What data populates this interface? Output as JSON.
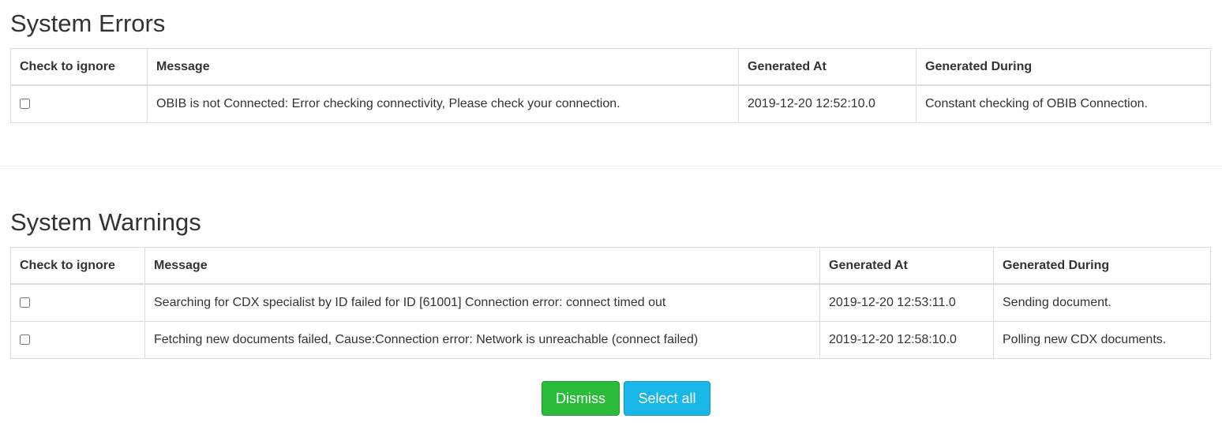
{
  "errors": {
    "title": "System Errors",
    "headers": [
      "Check to ignore",
      "Message",
      "Generated At",
      "Generated During"
    ],
    "rows": [
      {
        "message": "OBIB is not Connected: Error checking connectivity, Please check your connection.",
        "generated_at": "2019-12-20 12:52:10.0",
        "generated_during": "Constant checking of OBIB Connection."
      }
    ]
  },
  "warnings": {
    "title": "System Warnings",
    "headers": [
      "Check to ignore",
      "Message",
      "Generated At",
      "Generated During"
    ],
    "rows": [
      {
        "message": "Searching for CDX specialist by ID failed for ID [61001] Connection error: connect timed out",
        "generated_at": "2019-12-20 12:53:11.0",
        "generated_during": "Sending document."
      },
      {
        "message": "Fetching new documents failed, Cause:Connection error: Network is unreachable (connect failed)",
        "generated_at": "2019-12-20 12:58:10.0",
        "generated_during": "Polling new CDX documents."
      }
    ]
  },
  "actions": {
    "dismiss_label": "Dismiss",
    "select_all_label": "Select all"
  },
  "colors": {
    "dismiss": "#2bbd3a",
    "select_all": "#1ab6e8"
  }
}
